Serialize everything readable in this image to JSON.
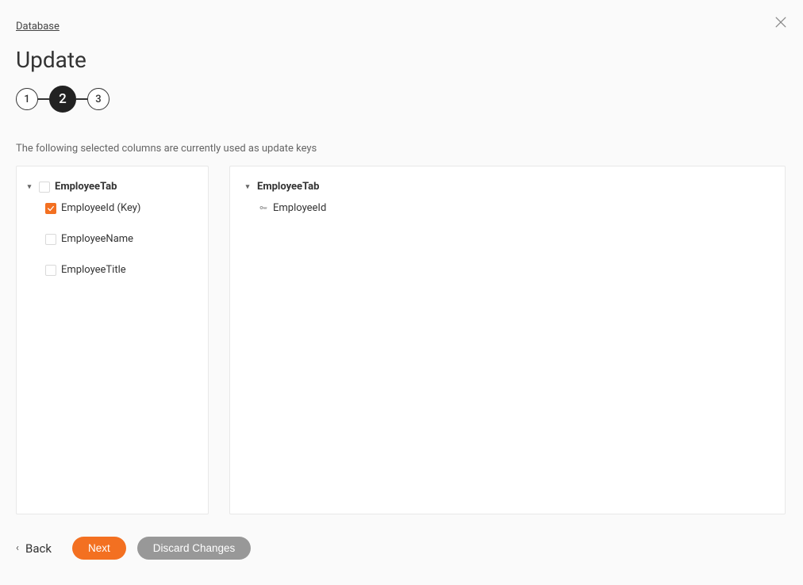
{
  "breadcrumb": "Database",
  "heading": "Update",
  "steps": {
    "s1": "1",
    "s2": "2",
    "s3": "3",
    "active": 2
  },
  "description": "The following selected columns are currently used as update keys",
  "leftPanel": {
    "table": "EmployeeTab",
    "columns": [
      {
        "label": "EmployeeId (Key)",
        "checked": true
      },
      {
        "label": "EmployeeName",
        "checked": false
      },
      {
        "label": "EmployeeTitle",
        "checked": false
      }
    ]
  },
  "rightPanel": {
    "table": "EmployeeTab",
    "keys": [
      {
        "label": "EmployeeId"
      }
    ]
  },
  "buttons": {
    "back": "Back",
    "next": "Next",
    "discard": "Discard Changes"
  }
}
